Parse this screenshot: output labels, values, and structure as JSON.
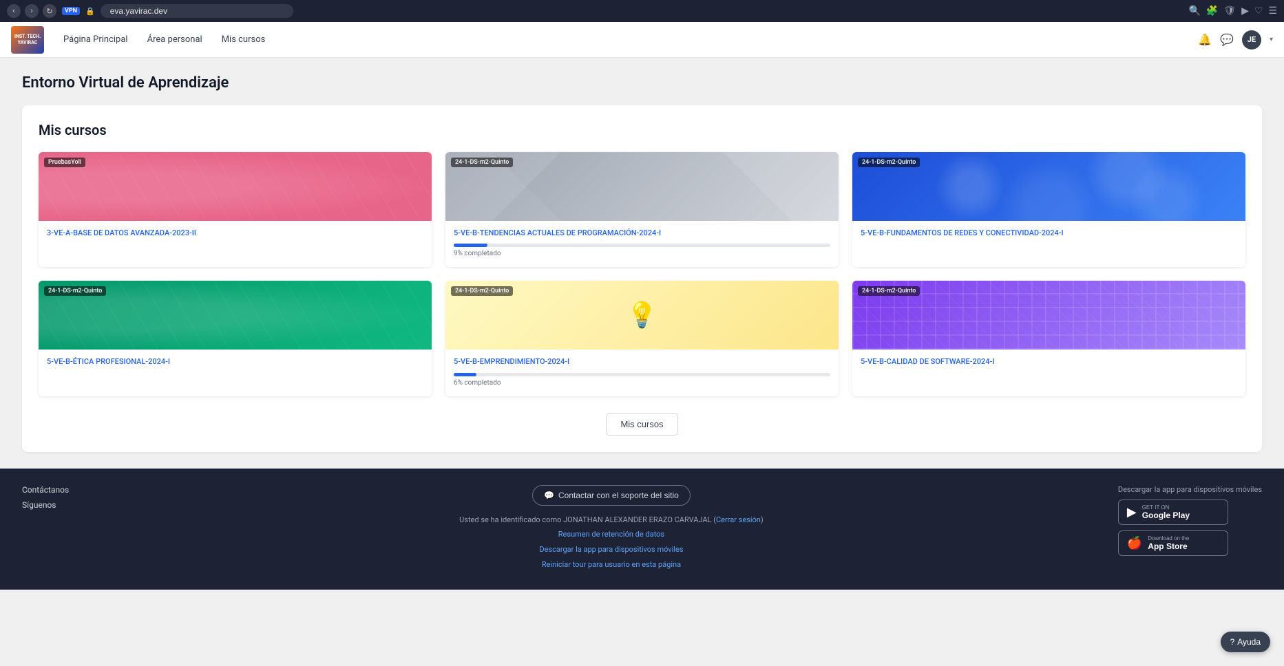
{
  "browser": {
    "url": "eva.yavirac.dev",
    "vpn_label": "VPN"
  },
  "nav": {
    "logo_text": "YAVIRAC",
    "links": [
      {
        "label": "Página Principal"
      },
      {
        "label": "Área personal"
      },
      {
        "label": "Mis cursos"
      }
    ],
    "user_initials": "JE"
  },
  "page": {
    "title": "Entorno Virtual de Aprendizaje",
    "courses_section_title": "Mis cursos"
  },
  "courses": [
    {
      "tag": "PruebasYoli",
      "name": "3-VE-A-BASE DE DATOS AVANZADA-2023-II",
      "thumb_type": "pink",
      "progress": null,
      "progress_label": null
    },
    {
      "tag": "24-1-DS-m2-Quinto",
      "name": "5-VE-B-TENDENCIAS ACTUALES DE PROGRAMACIÓN-2024-I",
      "thumb_type": "gray",
      "progress": 9,
      "progress_label": "9% completado"
    },
    {
      "tag": "24-1-DS-m2-Quinto",
      "name": "5-VE-B-FUNDAMENTOS DE REDES Y CONECTIVIDAD-2024-I",
      "thumb_type": "blue",
      "progress": null,
      "progress_label": null
    },
    {
      "tag": "24-1-DS-m2-Quinto",
      "name": "5-VE-B-ÉTICA PROFESIONAL-2024-I",
      "thumb_type": "green",
      "progress": null,
      "progress_label": null
    },
    {
      "tag": "24-1-DS-m2-Quinto",
      "name": "5-VE-B-EMPRENDIMIENTO-2024-I",
      "thumb_type": "idea",
      "progress": 6,
      "progress_label": "6% completado"
    },
    {
      "tag": "24-1-DS-m2-Quinto",
      "name": "5-VE-B-CALIDAD DE SOFTWARE-2024-I",
      "thumb_type": "purple",
      "progress": null,
      "progress_label": null
    }
  ],
  "mis_cursos_btn": "Mis cursos",
  "footer": {
    "contact_label": "Contáctanos",
    "follow_label": "Síguenos",
    "support_btn": "Contactar con el soporte del sitio",
    "logged_as": "Usted se ha identificado como JONATHAN ALEXANDER ERAZO CARVAJAL",
    "logout_link": "Cerrar sesión",
    "data_summary": "Resumen de retención de datos",
    "download_app": "Descargar la app para dispositivos móviles",
    "restart_tour": "Reiniciar tour para usuario en esta página",
    "mobile_title": "Descargar la app para dispositivos móviles",
    "google_play_small": "GET IT ON",
    "google_play_large": "Google Play",
    "app_store_small": "Download on the",
    "app_store_large": "App Store"
  },
  "help_btn": "Ayuda"
}
